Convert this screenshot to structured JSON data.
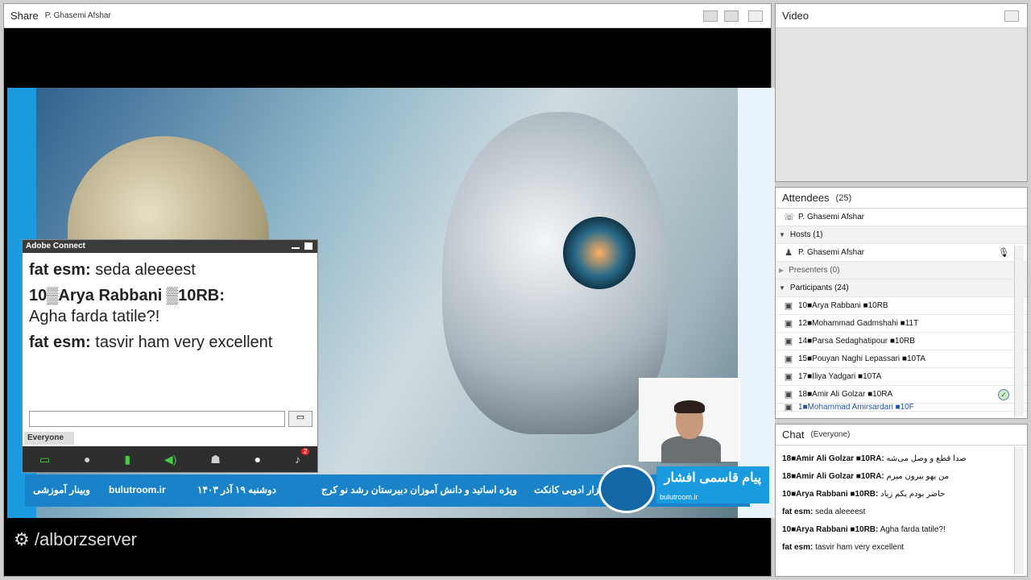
{
  "share": {
    "title": "Share",
    "presenter": "P. Ghasemi Afshar"
  },
  "slide": {
    "banner_texts": [
      "وبینار آموزشی",
      "bulutroom.ir",
      "دوشنبه ۱۹ آذر ۱۴۰۳",
      "ویژه اساتید و دانش آموزان دبیرستان رشد نو کرج",
      "فزار ادوبی کانکت"
    ],
    "logo_name": "پیام قاسمی افشار",
    "logo_url": "bulutroom.ir"
  },
  "popup": {
    "title": "Adobe Connect",
    "messages": [
      {
        "sender": "fat esm:",
        "text": "seda aleeeest"
      },
      {
        "sender": "10▒Arya Rabbani ▒10RB:",
        "text": "Agha farda tatile?!"
      },
      {
        "sender": "fat esm:",
        "text": "tasvir ham  very excellent"
      }
    ],
    "audience": "Everyone",
    "notification_count": "2"
  },
  "watermark": "/alborzserver",
  "video": {
    "title": "Video"
  },
  "attendees": {
    "title": "Attendees",
    "count": "(25)",
    "me": "P. Ghasemi Afshar",
    "hosts_label": "Hosts (1)",
    "host": "P. Ghasemi Afshar",
    "presenters_label": "Presenters (0)",
    "participants_label": "Participants (24)",
    "participants": [
      "10■Arya Rabbani ■10RB",
      "12■Mohammad Gadmshahi ■11T",
      "14■Parsa Sedaghatipour ■10RB",
      "15■Pouyan Naghi Lepassari ■10TA",
      "17■Iliya Yadgari ■10TA",
      "18■Amir Ali Golzar ■10RA",
      "1■Mohammad Amirsardari ■10F"
    ]
  },
  "chat": {
    "title": "Chat",
    "audience": "(Everyone)",
    "messages": [
      {
        "sender": "18■Amir Ali Golzar ■10RA:",
        "text": "صدا قطع و وصل می‌شه"
      },
      {
        "sender": "18■Amir Ali Golzar ■10RA:",
        "text": "من یهو بیرون میرم"
      },
      {
        "sender": "10■Arya Rabbani ■10RB:",
        "text": "حاضر بودم یکم زیاد"
      },
      {
        "sender": "fat esm:",
        "text": "seda aleeeest"
      },
      {
        "sender": "10■Arya Rabbani ■10RB:",
        "text": "Agha farda tatile?!"
      },
      {
        "sender": "fat esm:",
        "text": "tasvir ham  very excellent"
      }
    ]
  }
}
